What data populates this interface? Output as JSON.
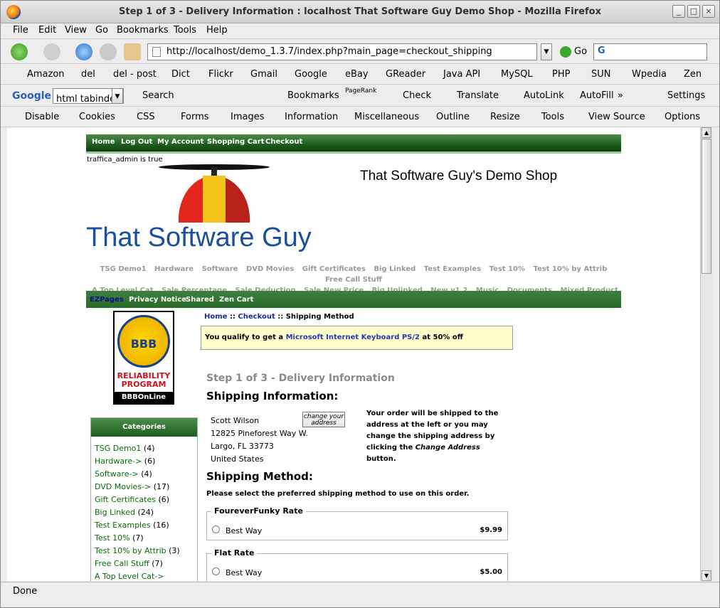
{
  "window": {
    "title": "Step 1 of 3 - Delivery Information : localhost That Software Guy Demo Shop - Mozilla Firefox"
  },
  "menu": [
    "File",
    "Edit",
    "View",
    "Go",
    "Bookmarks",
    "Tools",
    "Help"
  ],
  "nav": {
    "url": "http://localhost/demo_1.3.7/index.php?main_page=checkout_shipping",
    "go_label": "Go",
    "search_engine": "G"
  },
  "bookmarks": [
    "Amazon",
    "del",
    "del - post",
    "Dict",
    "Flickr",
    "Gmail",
    "Google",
    "eBay",
    "GReader",
    "Java API",
    "MySQL",
    "PHP",
    "SUN",
    "Wpedia",
    "Zen"
  ],
  "googlebar": {
    "logo": "Google",
    "query": "html tabinde",
    "search": "Search",
    "bookmarks": "Bookmarks",
    "pagerank": "PageRank",
    "check": "Check",
    "translate": "Translate",
    "autolink": "AutoLink",
    "autofill": "AutoFill",
    "more": "»",
    "settings": "Settings"
  },
  "webdev": [
    "Disable",
    "Cookies",
    "CSS",
    "Forms",
    "Images",
    "Information",
    "Miscellaneous",
    "Outline",
    "Resize",
    "Tools",
    "View Source",
    "Options"
  ],
  "status": "Done",
  "site": {
    "topnav": [
      "Home",
      "Log Out",
      "My Account",
      "Shopping Cart",
      "Checkout"
    ],
    "admin_note": "traffica_admin is true",
    "shop_name": "That Software Guy's Demo Shop",
    "logo_text": "That Software Guy",
    "cat_row1": [
      "TSG Demo1",
      "Hardware",
      "Software",
      "DVD Movies",
      "Gift Certificates",
      "Big Linked",
      "Test Examples",
      "Test 10%",
      "Test 10% by Attrib",
      "Free Call Stuff"
    ],
    "cat_row2": [
      "A Top Level Cat",
      "Sale Percentage",
      "Sale Deduction",
      "Sale New Price",
      "Big Unlinked",
      "New v1.2",
      "Music",
      "Documents",
      "Mixed Product Types"
    ],
    "ezpages": [
      "EZPages",
      "Privacy Notice",
      "Shared",
      "Zen Cart"
    ],
    "bbb": {
      "seal": "BBB",
      "line1": "RELIABILITY",
      "line2": "PROGRAM",
      "online": "BBBOnLine"
    },
    "categories_title": "Categories",
    "categories": [
      {
        "name": "TSG Demo1",
        "count": "(4)"
      },
      {
        "name": "Hardware->",
        "count": "(6)"
      },
      {
        "name": "Software->",
        "count": "(4)"
      },
      {
        "name": "DVD Movies->",
        "count": "(17)"
      },
      {
        "name": "Gift Certificates",
        "count": "(6)"
      },
      {
        "name": "Big Linked",
        "count": "(24)"
      },
      {
        "name": "Test Examples",
        "count": "(16)"
      },
      {
        "name": "Test 10%",
        "count": "(7)"
      },
      {
        "name": "Test 10% by Attrib",
        "count": "(3)"
      },
      {
        "name": "Free Call Stuff",
        "count": "(7)"
      },
      {
        "name": "A Top Level Cat->",
        "count": ""
      }
    ],
    "breadcrumb": {
      "home": "Home",
      "checkout": "Checkout",
      "current": "Shipping Method",
      "sep": "::"
    },
    "promo": {
      "pre": "You qualify to get a",
      "product": "Microsoft Internet Keyboard PS/2",
      "post": "at 50% off"
    },
    "step_title": "Step 1 of 3 - Delivery Information",
    "shipping_info_title": "Shipping Information:",
    "address": [
      "Scott Wilson",
      "12825 Pineforest Way W.",
      "Largo, FL 33773",
      "United States"
    ],
    "change_address": "change your address",
    "note": {
      "text1": "Your order will be shipped to the address at the left or you may change the shipping address by clicking the",
      "em": "Change Address",
      "text2": "button."
    },
    "shipping_method_title": "Shipping Method:",
    "select_text": "Please select the preferred shipping method to use on this order.",
    "methods": [
      {
        "name": "FoureverFunky Rate",
        "option": "Best Way",
        "price": "$9.99"
      },
      {
        "name": "Flat Rate",
        "option": "Best Way",
        "price": "$5.00"
      }
    ]
  }
}
